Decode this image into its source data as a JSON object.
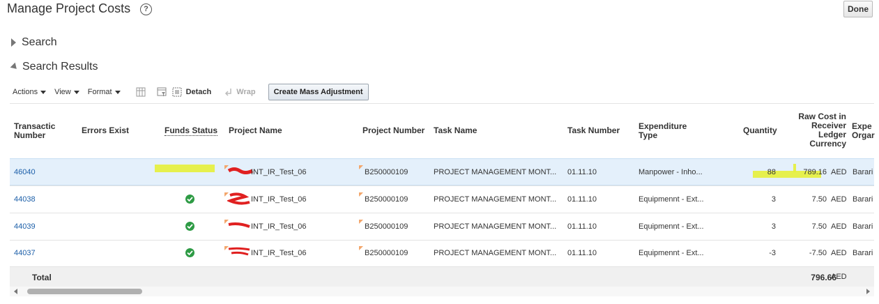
{
  "page": {
    "title": "Manage Project Costs",
    "help_icon": "question-circle-icon",
    "done_label": "Done"
  },
  "sections": {
    "search": "Search",
    "results": "Search Results"
  },
  "toolbar": {
    "actions": "Actions",
    "view": "View",
    "format": "Format",
    "detach": "Detach",
    "wrap": "Wrap",
    "create_mass_adjustment": "Create Mass Adjustment"
  },
  "table": {
    "columns": {
      "transaction_number": "Transactic\nNumber",
      "errors_exist": "Errors Exist",
      "funds_status": "Funds Status",
      "project_name": "Project Name",
      "project_number": "Project Number",
      "task_name": "Task Name",
      "task_number": "Task Number",
      "expenditure_type": "Expenditure\nType",
      "quantity": "Quantity",
      "raw_cost": "Raw Cost in\nReceiver\nLedger\nCurrency",
      "expenditure_org": "Expe\nOrgar"
    },
    "rows": [
      {
        "txn": "46040",
        "funds_ok": false,
        "project": "INT_IR_Test_06",
        "project_number": "B250000109",
        "task_name": "PROJECT MANAGEMENT MONT...",
        "task_number": "01.11.10",
        "exp_type": "Manpower - Inho...",
        "quantity": "88",
        "raw_cost": "789.16",
        "currency": "AED",
        "org": "Barari"
      },
      {
        "txn": "44038",
        "funds_ok": true,
        "project": "INT_IR_Test_06",
        "project_number": "B250000109",
        "task_name": "PROJECT MANAGEMENT MONT...",
        "task_number": "01.11.10",
        "exp_type": "Equipmennt - Ext...",
        "quantity": "3",
        "raw_cost": "7.50",
        "currency": "AED",
        "org": "Barari"
      },
      {
        "txn": "44039",
        "funds_ok": true,
        "project": "INT_IR_Test_06",
        "project_number": "B250000109",
        "task_name": "PROJECT MANAGEMENT MONT...",
        "task_number": "01.11.10",
        "exp_type": "Equipmennt - Ext...",
        "quantity": "3",
        "raw_cost": "7.50",
        "currency": "AED",
        "org": "Barari"
      },
      {
        "txn": "44037",
        "funds_ok": true,
        "project": "INT_IR_Test_06",
        "project_number": "B250000109",
        "task_name": "PROJECT MANAGEMENT MONT...",
        "task_number": "01.11.10",
        "exp_type": "Equipmennt - Ext...",
        "quantity": "-3",
        "raw_cost": "-7.50",
        "currency": "AED",
        "org": "Barari"
      }
    ],
    "total_label": "Total",
    "total_value": "796.66",
    "total_currency": "AED"
  },
  "colors": {
    "link": "#1b5ea8",
    "selected_row": "#e4f0fb",
    "success": "#2e9b45",
    "highlight": "#e6f03a",
    "redaction": "#e02020"
  }
}
